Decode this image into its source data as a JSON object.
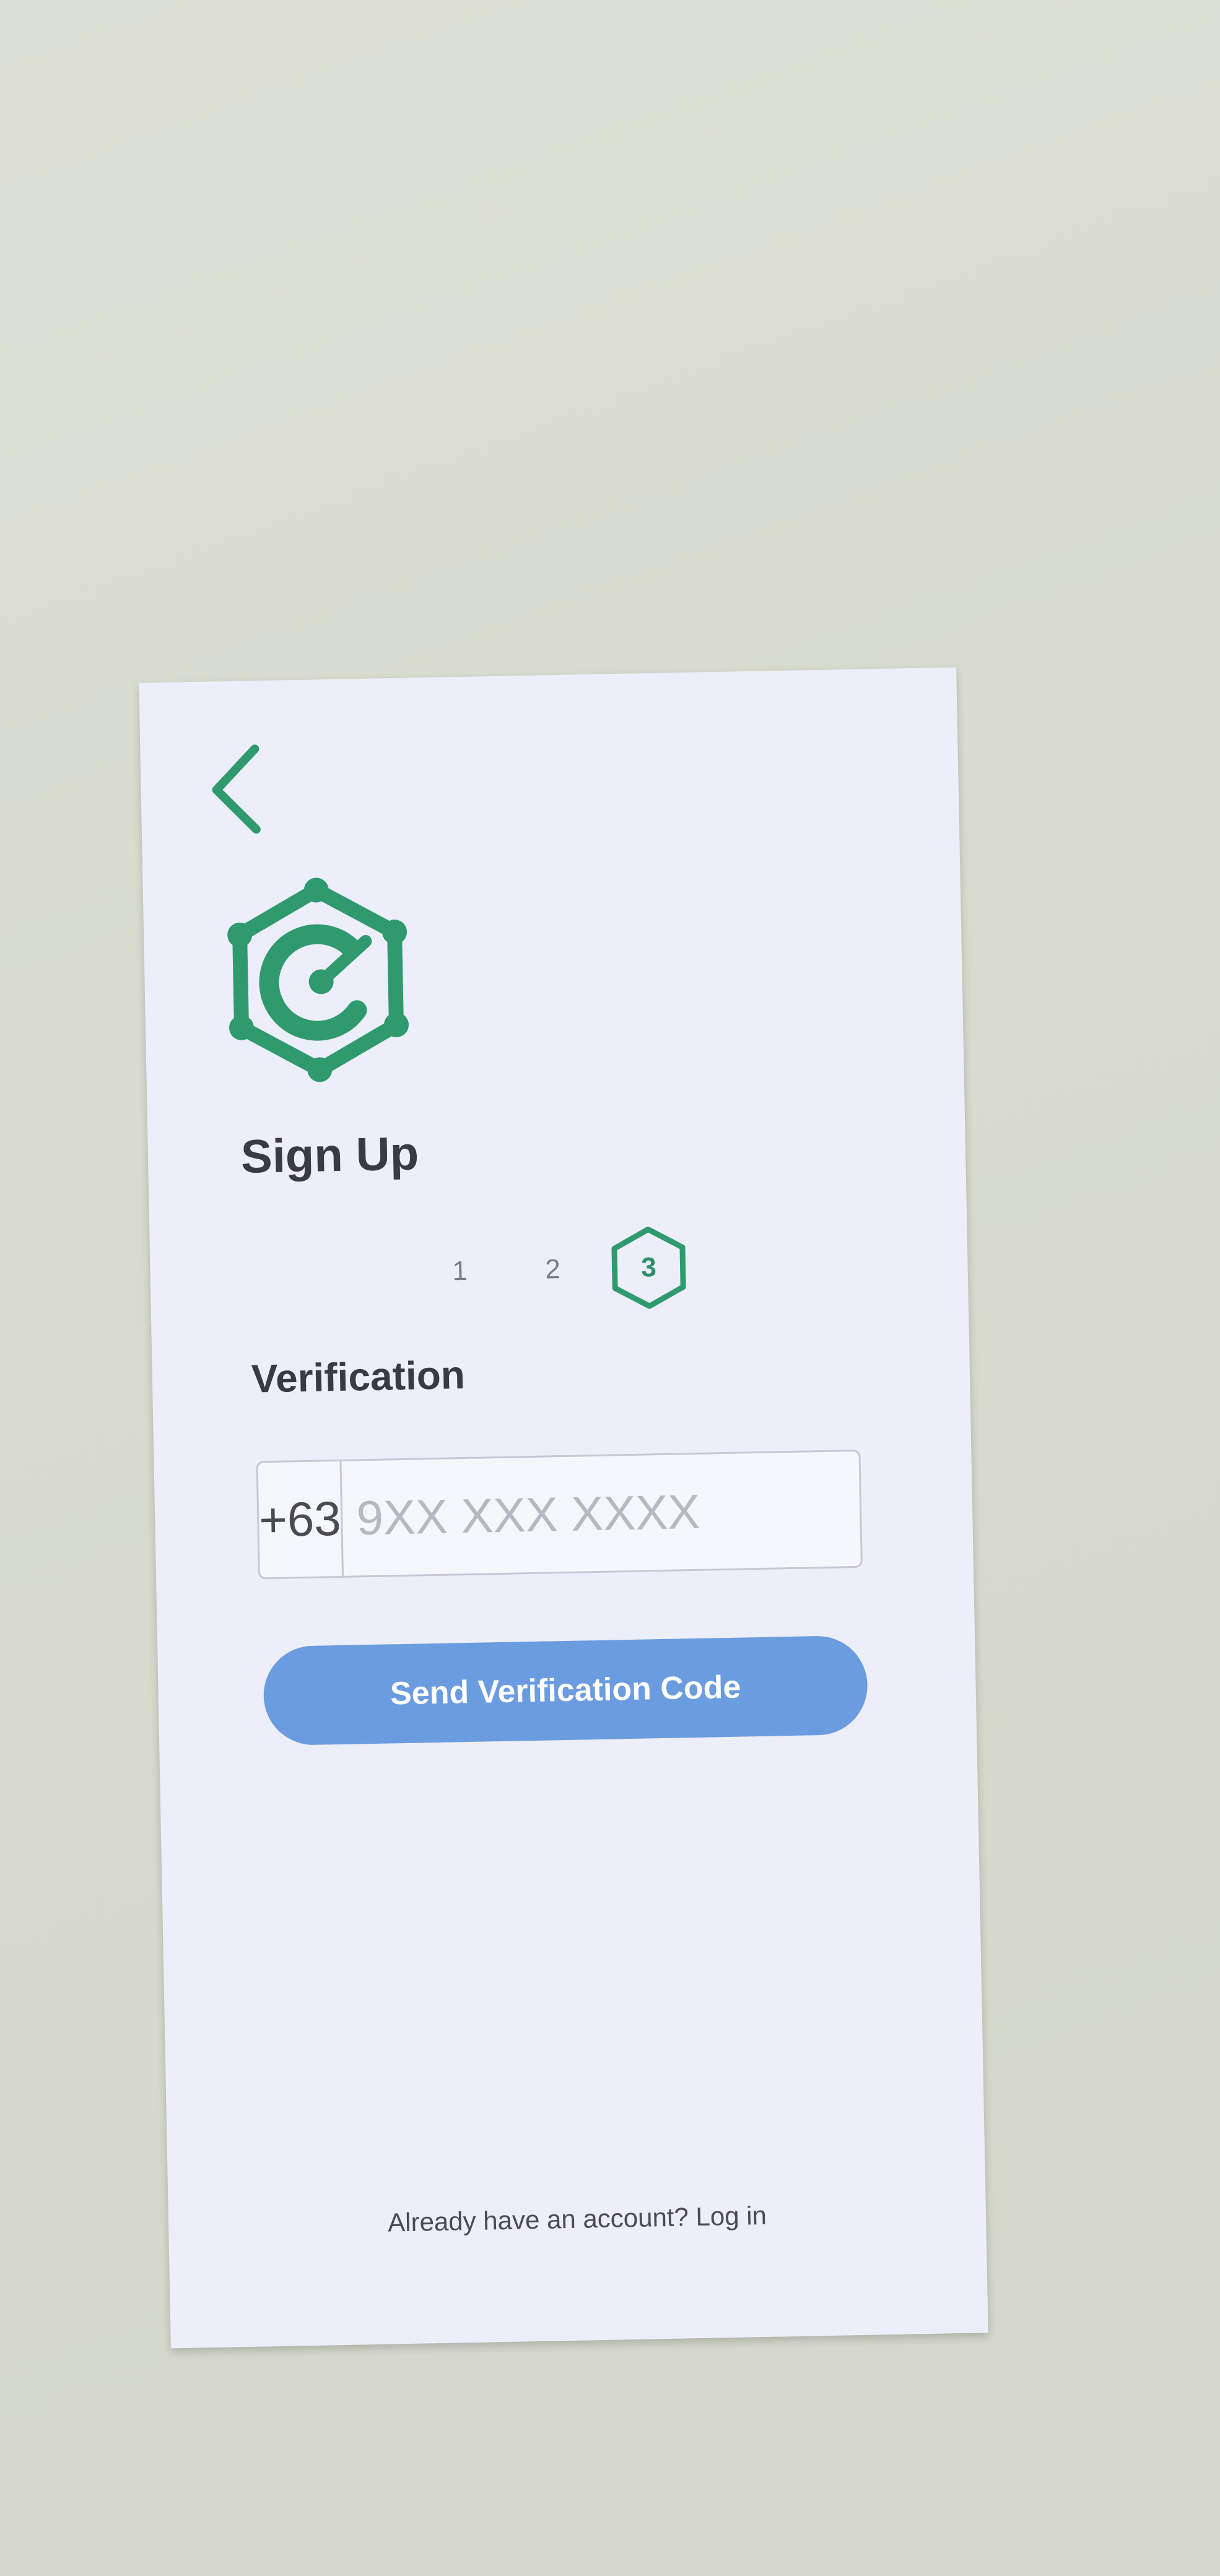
{
  "colors": {
    "brand_green": "#2f9a6e",
    "button_blue": "#6b9ce0",
    "background": "#eceef9"
  },
  "header": {
    "back_icon": "chevron-left-icon",
    "logo_icon": "hexagon-c-logo-icon"
  },
  "title": "Sign Up",
  "stepper": {
    "steps": [
      "1",
      "2",
      "3"
    ],
    "current_step": 3
  },
  "verification": {
    "section_title": "Verification",
    "country_code": "+63",
    "phone_placeholder": "9XX XXX XXXX",
    "phone_value": "",
    "send_button_label": "Send Verification Code"
  },
  "footer": {
    "login_prompt": "Already have an account? Log in"
  }
}
